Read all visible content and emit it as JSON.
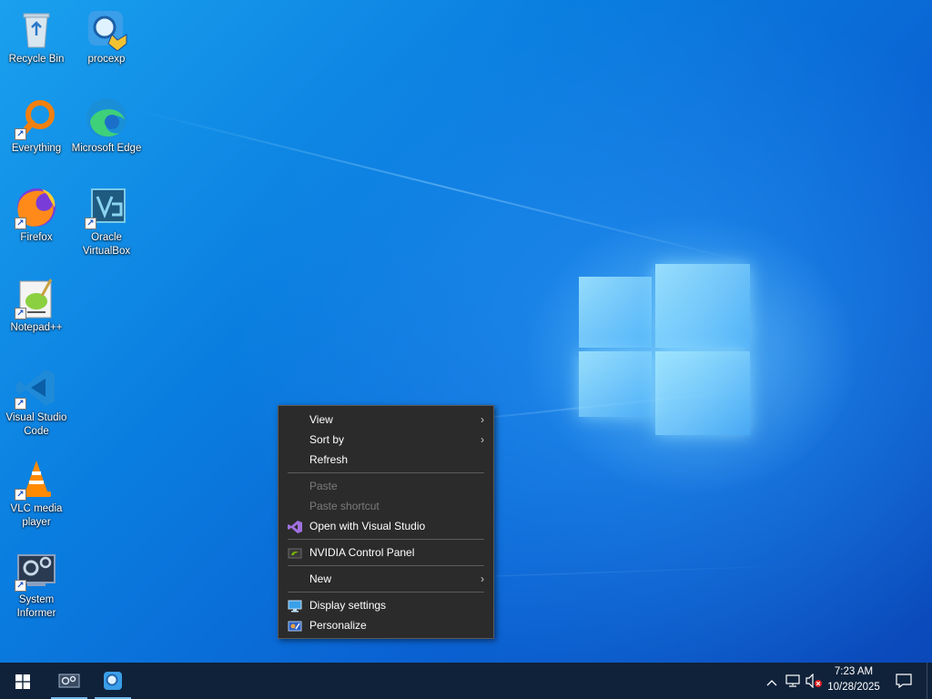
{
  "desktop": {
    "icons": [
      {
        "label": "Recycle Bin",
        "icon": "recycle-bin-icon"
      },
      {
        "label": "procexp",
        "icon": "procexp-icon"
      },
      {
        "label": "Everything",
        "icon": "everything-search-icon"
      },
      {
        "label": "Microsoft Edge",
        "icon": "edge-icon"
      },
      {
        "label": "Firefox",
        "icon": "firefox-icon"
      },
      {
        "label": "Oracle VirtualBox",
        "icon": "virtualbox-icon"
      },
      {
        "label": "Notepad++",
        "icon": "notepadpp-icon"
      },
      {
        "label": "Visual Studio Code",
        "icon": "vscode-icon"
      },
      {
        "label": "VLC media player",
        "icon": "vlc-icon"
      },
      {
        "label": "System Informer",
        "icon": "system-informer-icon"
      }
    ]
  },
  "context_menu": {
    "view": "View",
    "sort_by": "Sort by",
    "refresh": "Refresh",
    "paste": "Paste",
    "paste_shortcut": "Paste shortcut",
    "open_vs": "Open with Visual Studio",
    "nvidia": "NVIDIA Control Panel",
    "new": "New",
    "display_settings": "Display settings",
    "personalize": "Personalize",
    "submenu_arrow": "›"
  },
  "taskbar": {
    "time": "7:23 AM",
    "date": "10/28/2025",
    "colors": {
      "bar": "#10223a",
      "accent": "#76b9ed"
    }
  }
}
